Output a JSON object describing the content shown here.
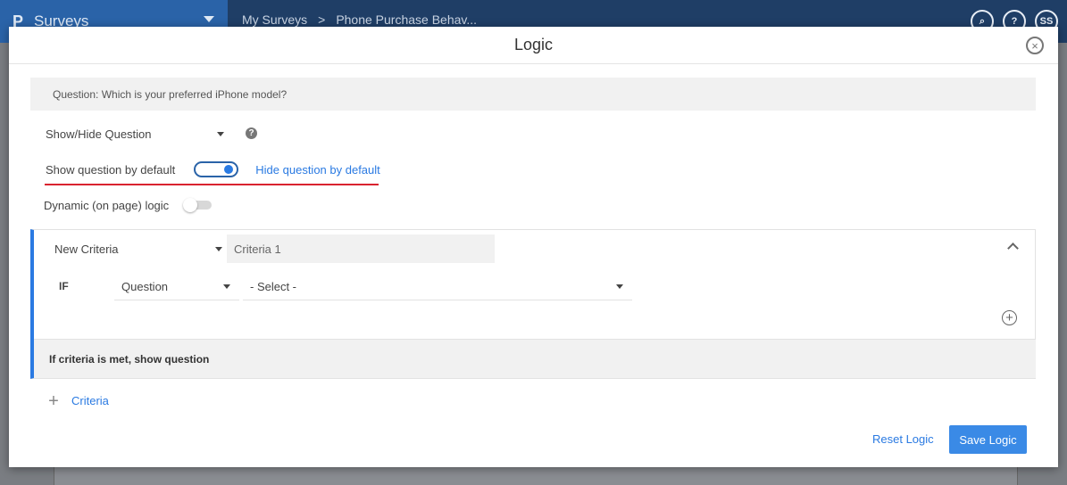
{
  "app": {
    "brand_logo": "P",
    "brand_name": "Surveys",
    "breadcrumbs": [
      "My Surveys",
      ">",
      "Phone Purchase Behav..."
    ],
    "top_icons": [
      {
        "icon": "search-icon",
        "glyph": "⌕"
      },
      {
        "icon": "help-icon",
        "glyph": "?"
      },
      {
        "icon": "avatar",
        "glyph": "SS"
      }
    ]
  },
  "modal": {
    "title": "Logic",
    "close_glyph": "×",
    "question_text": "Question: Which is your preferred iPhone model?",
    "showhide_select": "Show/Hide Question",
    "help_glyph": "?",
    "default_toggle": {
      "left_label": "Show question by default",
      "right_label": "Hide question by default",
      "on": true
    },
    "dynamic_logic": {
      "label": "Dynamic (on page) logic",
      "on": false
    },
    "criteria": {
      "type_select": "New Criteria",
      "name_value": "Criteria 1",
      "if_label": "IF",
      "question_select": "Question",
      "value_select": "- Select -",
      "add_glyph": "+",
      "result_text": "If criteria is met, show question"
    },
    "add_criteria": {
      "glyph": "+",
      "label": "Criteria"
    },
    "footer": {
      "reset_label": "Reset Logic",
      "save_label": "Save Logic"
    }
  },
  "colors": {
    "accent": "#2a7ae2",
    "topbar": "#1f3e66",
    "brand_bar": "#2a63a8",
    "highlight_underline": "#d9232f"
  }
}
